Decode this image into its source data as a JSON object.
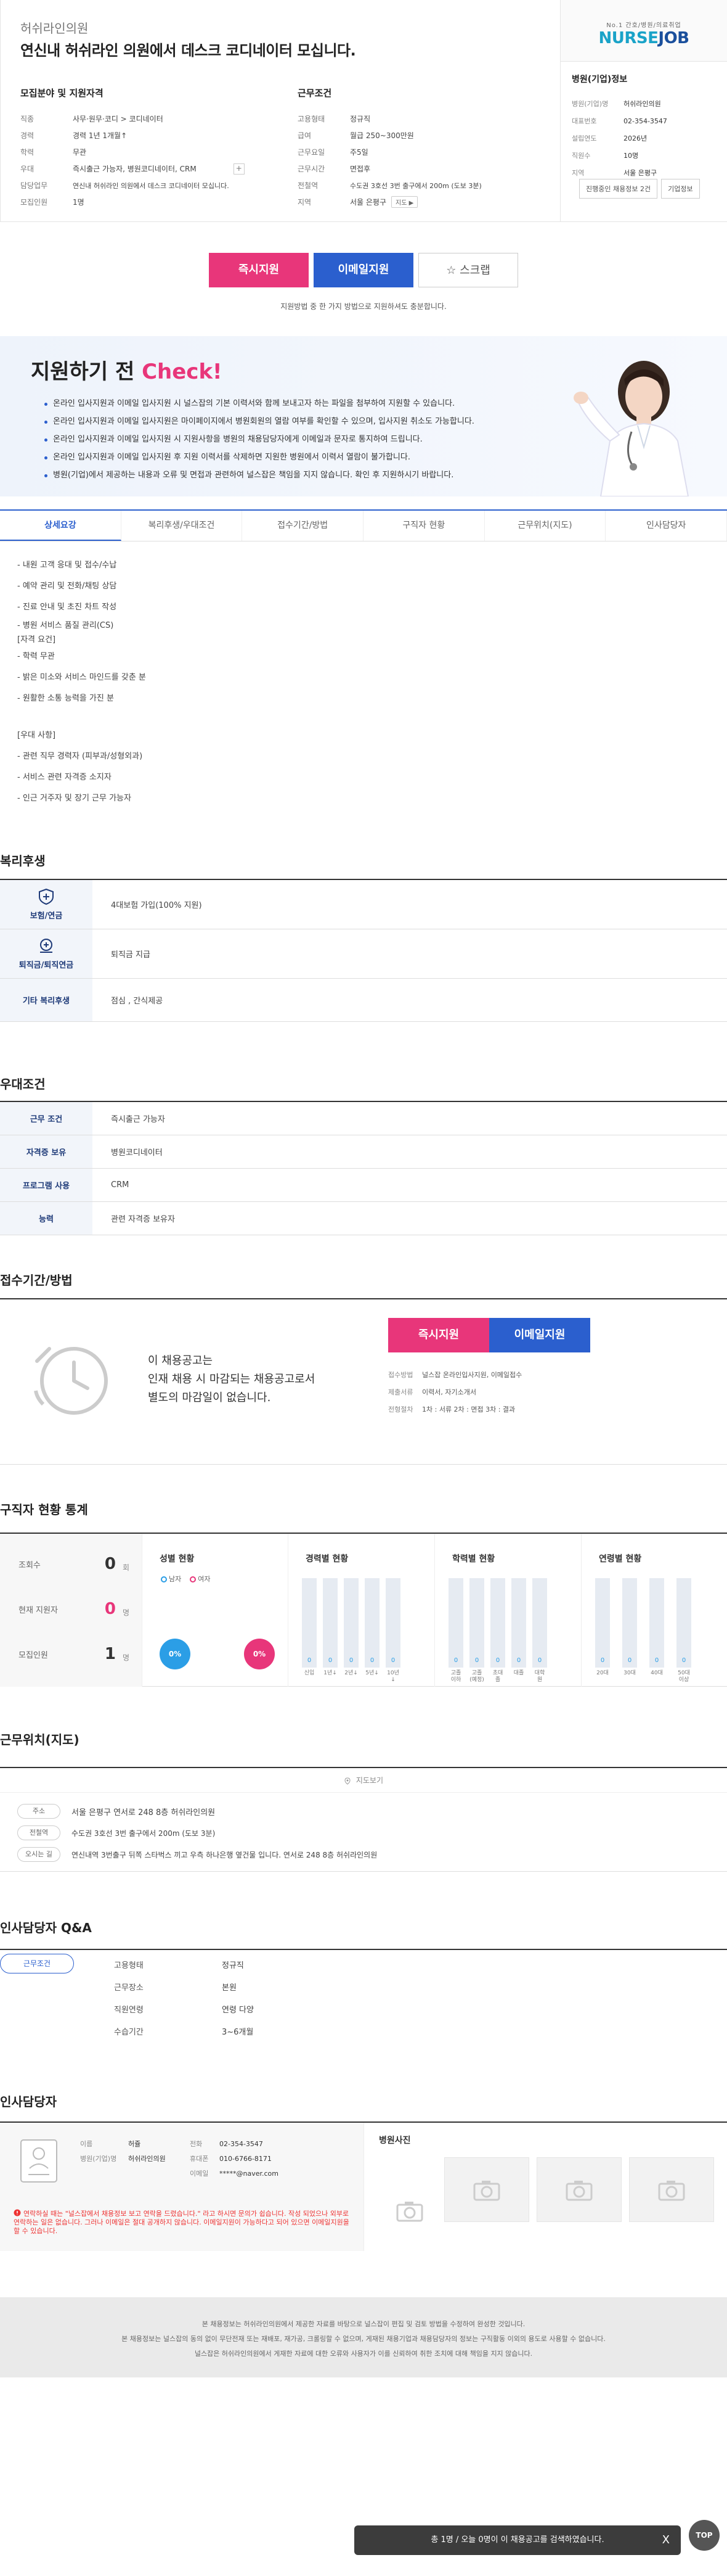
{
  "header": {
    "clinic_name": "허쉬라인의원",
    "job_title": "연신내 허쉬라인 의원에서 데스크 코디네이터 모십니다.",
    "recruit_title": "모집분야 및 지원자격",
    "recruit_rows": [
      {
        "k": "직종",
        "v": "사무·원무·코디 > 코디네이터"
      },
      {
        "k": "경력",
        "v": "경력 1년 1개월↑"
      },
      {
        "k": "학력",
        "v": "무관"
      },
      {
        "k": "우대",
        "v": "즉시출근 가능자, 병원코디네이터, CRM"
      },
      {
        "k": "담당업무",
        "v": "연신내 허쉬라인 의원에서 데스크 코디네이터 모십니다."
      },
      {
        "k": "모집인원",
        "v": "1명"
      }
    ],
    "work_title": "근무조건",
    "work_rows": [
      {
        "k": "고용형태",
        "v": "정규직"
      },
      {
        "k": "급여",
        "v": "월급 250~300만원"
      },
      {
        "k": "근무요일",
        "v": "주5일"
      },
      {
        "k": "근무시간",
        "v": "면접후"
      },
      {
        "k": "전철역",
        "v": "수도권 3호선 3번 출구에서 200m (도보 3분)"
      },
      {
        "k": "지역",
        "v": "서울 은평구"
      }
    ],
    "plus": "+",
    "map_label": "지도 ▶"
  },
  "logo": {
    "sub": "No.1 간호/병원/의료취업",
    "main_a": "NURSE",
    "main_b": "JOB"
  },
  "hospital": {
    "title": "병원(기업)정보",
    "rows": [
      {
        "k": "병원(기업)명",
        "v": "허쉬라인의원"
      },
      {
        "k": "대표번호",
        "v": "02-354-3547"
      },
      {
        "k": "설립연도",
        "v": "2026년"
      },
      {
        "k": "직원수",
        "v": "10명"
      },
      {
        "k": "지역",
        "v": "서울 은평구"
      }
    ],
    "btn_jobs": "진행중인 채용정보 2건",
    "btn_info": "기업정보"
  },
  "apply": {
    "instant": "즉시지원",
    "email": "이메일지원",
    "scrap": "☆ 스크랩",
    "note": "지원방법 중 한 가지 방법으로 지원하셔도 충분합니다."
  },
  "check": {
    "title_a": "지원하기 전 ",
    "title_b": "Check!",
    "items": [
      "온라인 입사지원과 이메일 입사지원 시 널스잡의 기본 이력서와 함께 보내고자 하는 파일을 첨부하여 지원할 수 있습니다.",
      "온라인 입사지원과 이메일 입사지원은 마이페이지에서 병원회원의 열람 여부를 확인할 수 있으며, 입사지원 취소도 가능합니다.",
      "온라인 입사지원과 이메일 입사지원 시 지원사항을 병원의 채용담당자에게 이메일과 문자로 통지하여 드립니다.",
      "온라인 입사지원과 이메일 입사지원 후 지원 이력서를 삭제하면 지원한 병원에서 이력서 열람이 불가합니다.",
      "병원(기업)에서 제공하는 내용과 오류 및 면접과 관련하여 널스잡은 책임을 지지 않습니다. 확인 후 지원하시기 바랍니다."
    ]
  },
  "tabs": [
    "상세요강",
    "복리후생/우대조건",
    "접수기간/방법",
    "구직자 현황",
    "근무위치(지도)",
    "인사담당자"
  ],
  "description": [
    "- 내원 고객 응대 및 접수/수납",
    "- 예약 관리 및 전화/채팅 상담",
    "- 진료 안내 및 초진 차트 작성",
    "- 병원 서비스 품질 관리(CS)",
    "[자격 요건]",
    "- 학력 무관",
    "- 밝은 미소와 서비스 마인드를 갖춘 분",
    "- 원활한 소통 능력을 가진 분",
    "",
    "[우대 사항]",
    "- 관련 직무 경력자 (피부과/성형외과)",
    "- 서비스 관련 자격증 소지자",
    "- 인근 거주자 및 장기 근무 가능자"
  ],
  "welfare": {
    "title": "복리후생",
    "rows": [
      {
        "k": "보험/연금",
        "v": "4대보험 가입(100% 지원)"
      },
      {
        "k": "퇴직금/퇴직연금",
        "v": "퇴직금 지급"
      },
      {
        "k": "기타 복리후생",
        "v": "점심 , 간식제공"
      }
    ]
  },
  "pref": {
    "title": "우대조건",
    "rows": [
      {
        "k": "근무 조건",
        "v": "즉시출근 가능자"
      },
      {
        "k": "자격증 보유",
        "v": "병원코디네이터"
      },
      {
        "k": "프로그램 사용",
        "v": "CRM"
      },
      {
        "k": "능력",
        "v": "관련 자격증 보유자"
      }
    ]
  },
  "receive": {
    "title": "접수기간/방법",
    "msg1": "이 채용공고는",
    "msg2": "인재 채용 시 마감되는 채용공고로서",
    "msg3": "별도의 마감일이 없습니다.",
    "rows": [
      {
        "k": "접수방법",
        "v": "널스잡 온라인입사지원, 이메일접수"
      },
      {
        "k": "제출서류",
        "v": "이력서, 자기소개서"
      },
      {
        "k": "전형절차",
        "v": "1차 : 서류   2차 : 면접   3차 : 결과"
      }
    ]
  },
  "stats": {
    "title": "구직자 현황 통계",
    "views_label": "조회수",
    "views": "0",
    "views_unit": "회",
    "now_label": "현재 지원자",
    "now": "0",
    "now_unit": "명",
    "total_label": "모집인원",
    "total": "1",
    "total_unit": "명",
    "gender_title": "성별 현황",
    "male": "남자",
    "female": "여자",
    "male_pct": "0%",
    "female_pct": "0%",
    "career_title": "경력별 현황",
    "career": [
      {
        "l": "신입",
        "v": "0"
      },
      {
        "l": "1년↓",
        "v": "0"
      },
      {
        "l": "2년↓",
        "v": "0"
      },
      {
        "l": "5년↓",
        "v": "0"
      },
      {
        "l": "10년↓",
        "v": "0"
      }
    ],
    "edu_title": "학력별 현황",
    "edu": [
      {
        "l": "고졸이하",
        "v": "0"
      },
      {
        "l": "고졸(예정)",
        "v": "0"
      },
      {
        "l": "초대졸",
        "v": "0"
      },
      {
        "l": "대졸",
        "v": "0"
      },
      {
        "l": "대학원",
        "v": "0"
      }
    ],
    "age_title": "연령별 현황",
    "age": [
      {
        "l": "20대",
        "v": "0"
      },
      {
        "l": "30대",
        "v": "0"
      },
      {
        "l": "40대",
        "v": "0"
      },
      {
        "l": "50대이상",
        "v": "0"
      }
    ]
  },
  "location": {
    "title": "근무위치(지도)",
    "map_btn": "지도보기",
    "rows": [
      {
        "k": "주소",
        "v": "서울 은평구 연서로 248 8층 허쉬라인의원"
      },
      {
        "k": "전철역",
        "v": "수도권 3호선 3번 출구에서 200m (도보 3분)"
      },
      {
        "k": "오시는 길",
        "v": "연신내역 3번출구 뒤쪽 스타벅스 끼고 우측 하나은행 옆건물 입니다. 연서로 248 8층 허쉬라인의원"
      }
    ]
  },
  "qa": {
    "title": "인사담당자 Q&A",
    "side": "근무조건",
    "rows": [
      {
        "k": "고용형태",
        "v": "정규직"
      },
      {
        "k": "근무장소",
        "v": "본원"
      },
      {
        "k": "직원연령",
        "v": "연령 다양"
      },
      {
        "k": "수습기간",
        "v": "3~6개월"
      }
    ]
  },
  "manager": {
    "title": "인사담당자",
    "name_k": "이름",
    "name_v": "허쥴",
    "dept_k": "병원(기업)명",
    "dept_v": "허쉬라인의원",
    "tel_k": "전화",
    "tel_v": "02-354-3547",
    "mobile_k": "휴대폰",
    "mobile_v": "010-6766-8171",
    "email_k": "이메일",
    "email_v": "*****@naver.com",
    "note": "연락하실 때는 \"널스잡에서 채용정보 보고 연락을 드렸습니다.\" 라고 하시면 문의가 쉽습니다. 작성 되었으나 외부로 연락하는 일은 없습니다. 그러나 이메일은 절대 공개하지 않습니다. 이메일지원이 가능하다고 되어 있으면 이메일지원을 할 수 있습니다.",
    "photo_title": "병원사진"
  },
  "footer": {
    "line1": "본 채용정보는 허쉬라인의원에서 제공한 자료를 바탕으로 널스잡이 편집 및 검토 방법을 수정하여 완성한 것입니다.",
    "line2": "본 채용정보는 널스잡의 동의 없이 무단전재 또는 재배포, 재가공, 크롤링할 수 없으며, 게재된 채용기업과 채용담당자의 정보는 구직활동 이외의 용도로 사용할 수 없습니다.",
    "line3": "널스잡은 허쉬라인의원에서 게재한 자료에 대한 오류와 사용자가 이를 신뢰하여 취한 조치에 대해 책임을 지지 않습니다."
  },
  "float_bar": {
    "text": "총 1명 / 오늘 0명이 이 채용공고를 검색하였습니다.",
    "close": "X"
  },
  "top_btn": "TOP"
}
